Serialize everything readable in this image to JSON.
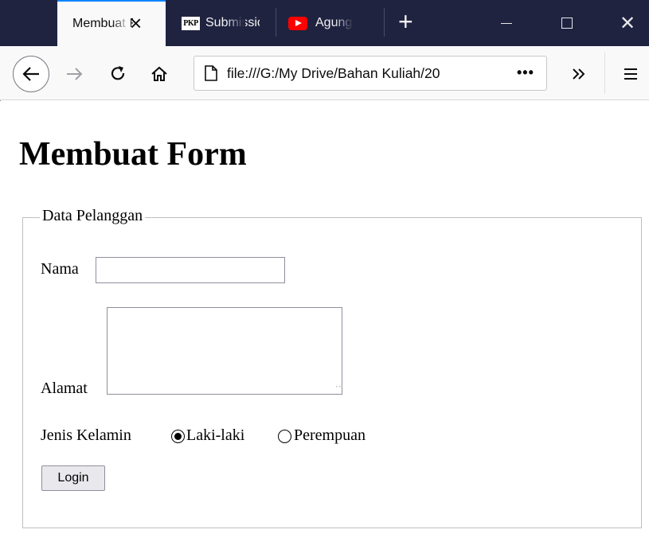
{
  "browser": {
    "tabs": [
      {
        "label": "Membuat Form",
        "active": true
      },
      {
        "label": "Submission",
        "icon": "pkp-icon",
        "icon_text": "PKP"
      },
      {
        "label": "Agung",
        "icon": "youtube-icon"
      }
    ],
    "url": "file:///G:/My Drive/Bahan Kuliah/20",
    "page_actions": "•••",
    "colors": {
      "tabbar": "#202340",
      "active_tab_accent": "#0a84ff",
      "toolbar": "#f9f9fa"
    }
  },
  "page": {
    "title": "Membuat Form",
    "fieldset_legend": "Data Pelanggan",
    "nama_label": "Nama",
    "nama_value": "",
    "alamat_label": "Alamat",
    "alamat_value": "",
    "gender_label": "Jenis Kelamin",
    "gender_options": [
      {
        "label": "Laki-laki",
        "checked": true
      },
      {
        "label": "Perempuan",
        "checked": false
      }
    ],
    "submit_label": "Login"
  }
}
